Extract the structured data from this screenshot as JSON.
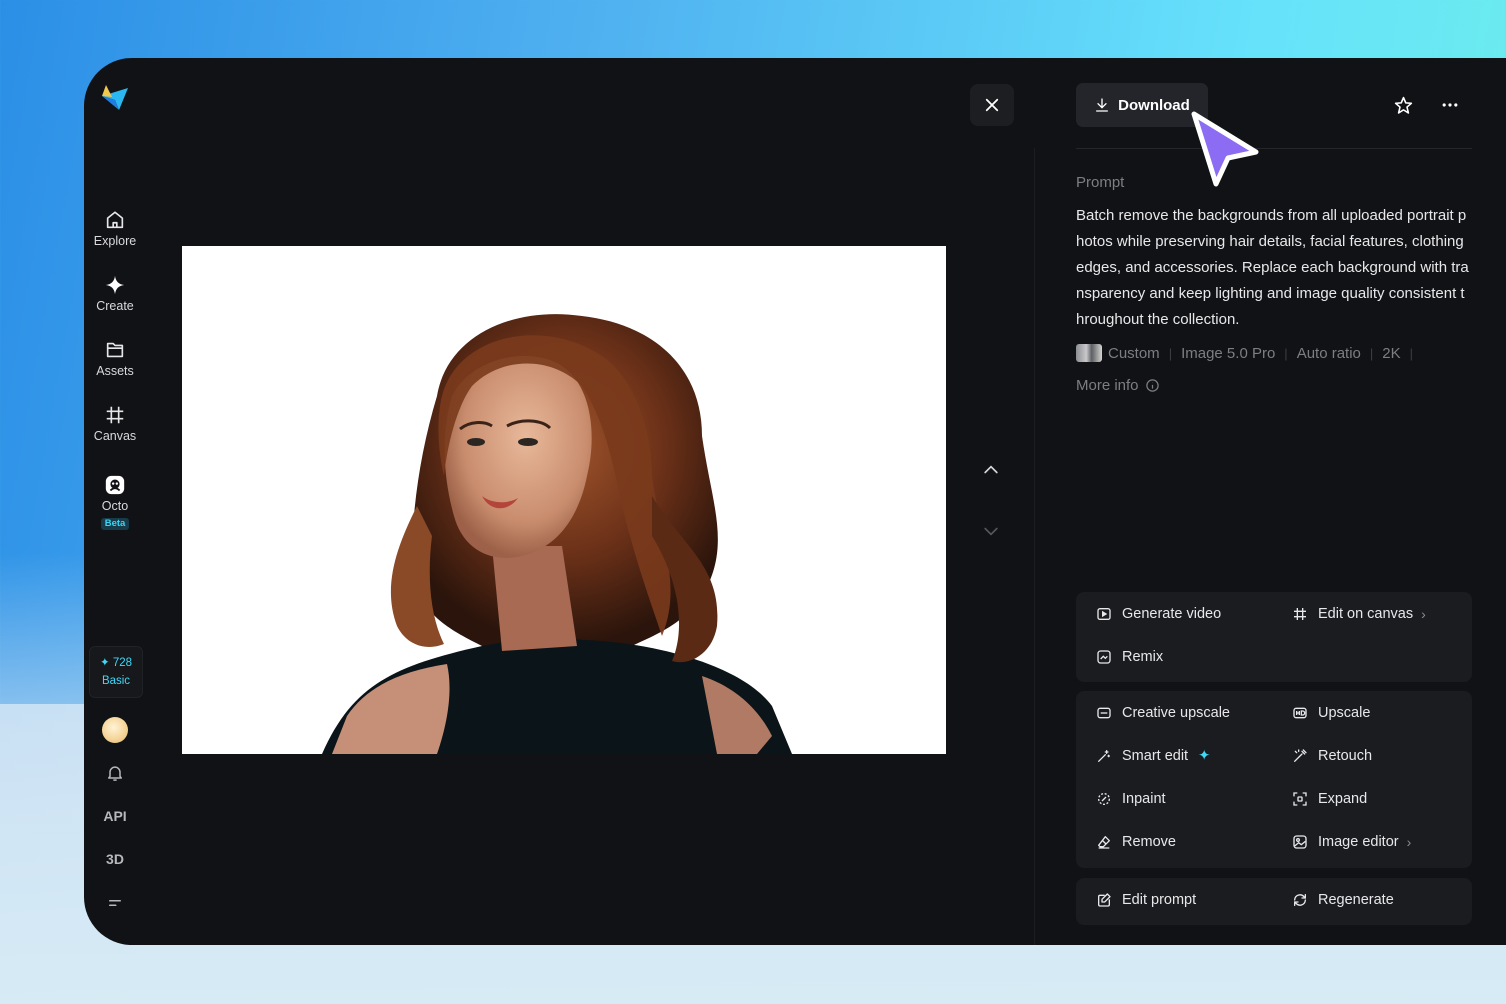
{
  "sidebar": {
    "items": [
      {
        "label": "Explore",
        "icon": "home-icon"
      },
      {
        "label": "Create",
        "icon": "sparkle-icon"
      },
      {
        "label": "Assets",
        "icon": "folder-icon"
      },
      {
        "label": "Canvas",
        "icon": "canvas-icon"
      },
      {
        "label": "Octo",
        "icon": "octo-icon",
        "badge": "Beta"
      }
    ],
    "credits": {
      "value": "728",
      "plan": "Basic"
    },
    "api_label": "API",
    "three_d_label": "3D"
  },
  "viewer": {
    "image_description_icon": "portrait-image"
  },
  "toolbar": {
    "download_label": "Download"
  },
  "prompt": {
    "label": "Prompt",
    "text": "Batch remove the backgrounds from all uploaded portrait photos while preserving hair details, facial features, clothing edges, and accessories. Replace each background with transparency and keep lighting and image quality consistent throughout the collection.",
    "meta": [
      "Custom",
      "Image 5.0 Pro",
      "Auto ratio",
      "2K"
    ],
    "more_info": "More info"
  },
  "actions": {
    "group1": {
      "generate_video": "Generate video",
      "edit_on_canvas": "Edit on canvas",
      "remix": "Remix"
    },
    "group2": {
      "creative_upscale": "Creative upscale",
      "upscale": "Upscale",
      "smart_edit": "Smart edit",
      "retouch": "Retouch",
      "inpaint": "Inpaint",
      "expand": "Expand",
      "remove": "Remove",
      "image_editor": "Image editor"
    },
    "group3": {
      "edit_prompt": "Edit prompt",
      "regenerate": "Regenerate"
    }
  },
  "colors": {
    "accent": "#3fd8f7",
    "cursor": "#8b6cf2",
    "panel_bg": "#111215",
    "card_bg": "#1b1c20"
  }
}
